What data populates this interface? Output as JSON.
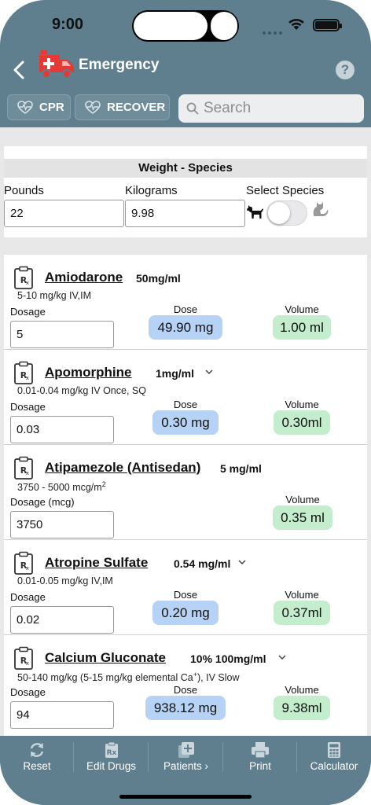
{
  "status_bar": {
    "time": "9:00"
  },
  "nav": {
    "title": "Emergency",
    "help": "?"
  },
  "toolbar": {
    "cpr": "CPR",
    "recover": "RECOVER",
    "search_placeholder": "Search"
  },
  "weight_species": {
    "header": "Weight - Species",
    "pounds_label": "Pounds",
    "pounds_value": "22",
    "kilograms_label": "Kilograms",
    "kilograms_value": "9.98",
    "species_label": "Select Species"
  },
  "drugs": [
    {
      "name": "Amiodarone",
      "concentration": "50mg/ml",
      "description": "5-10 mg/kg IV,IM",
      "dosage_label": "Dosage",
      "dosage": "5",
      "dose_label": "Dose",
      "dose": "49.90 mg",
      "volume_label": "Volume",
      "volume": "1.00 ml"
    },
    {
      "name": "Apomorphine",
      "concentration": "1mg/ml",
      "description": "0.01-0.04 mg/kg IV Once, SQ",
      "dosage_label": "Dosage",
      "dosage": "0.03",
      "dose_label": "Dose",
      "dose": "0.30 mg",
      "volume_label": "Volume",
      "volume": "0.30ml"
    },
    {
      "name": "Atipamezole (Antisedan)",
      "concentration": "5 mg/ml",
      "description": "3750 - 5000 mcg/m",
      "description_sup": "2",
      "dosage_label": "Dosage (mcg)",
      "dosage": "3750",
      "volume_label": "Volume",
      "volume": "0.35 ml"
    },
    {
      "name": "Atropine Sulfate",
      "concentration": "0.54 mg/ml",
      "description": "0.01-0.05 mg/kg IV,IM",
      "dosage_label": "Dosage",
      "dosage": "0.02",
      "dose_label": "Dose",
      "dose": "0.20 mg",
      "volume_label": "Volume",
      "volume": "0.37ml"
    },
    {
      "name": "Calcium Gluconate",
      "concentration": "10% 100mg/ml",
      "description": "50-140 mg/kg (5-15 mg/kg elemental Ca",
      "description_sup": "+",
      "description_tail": "), IV Slow",
      "dosage_label": "Dosage",
      "dosage": "94",
      "dose_label": "Dose",
      "dose": "938.12 mg",
      "volume_label": "Volume",
      "volume": "9.38ml"
    }
  ],
  "tabbar": {
    "reset": "Reset",
    "edit_drugs": "Edit Drugs",
    "patients": "Patients",
    "print": "Print",
    "calculator": "Calculator"
  },
  "colors": {
    "header": "#5f7f8f",
    "dose_pill": "#b6d2f5",
    "volume_pill": "#c3edcc",
    "logo": "#e53935"
  }
}
